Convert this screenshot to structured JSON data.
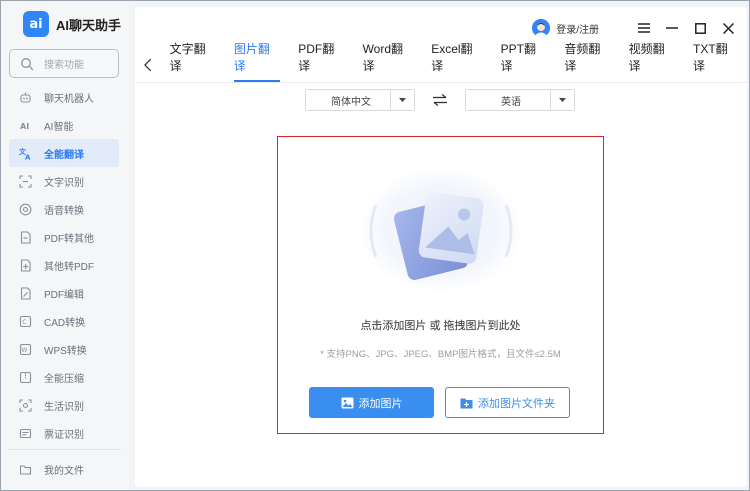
{
  "app": {
    "logo_text": "ai",
    "name": "AI聊天助手"
  },
  "search": {
    "placeholder": "搜索功能"
  },
  "sidebar": {
    "items": [
      {
        "label": "聊天机器人",
        "icon": "robot-icon",
        "active": false
      },
      {
        "label": "AI智能",
        "icon": "ai-icon",
        "active": false
      },
      {
        "label": "全能翻译",
        "icon": "translate-icon",
        "active": true
      },
      {
        "label": "文字识别",
        "icon": "scan-text-icon",
        "active": false
      },
      {
        "label": "语音转换",
        "icon": "audio-icon",
        "active": false
      },
      {
        "label": "PDF转其他",
        "icon": "pdf-convert-icon",
        "active": false
      },
      {
        "label": "其他转PDF",
        "icon": "to-pdf-icon",
        "active": false
      },
      {
        "label": "PDF编辑",
        "icon": "pdf-edit-icon",
        "active": false
      },
      {
        "label": "CAD转换",
        "icon": "cad-icon",
        "active": false
      },
      {
        "label": "WPS转换",
        "icon": "wps-icon",
        "active": false
      },
      {
        "label": "全能压缩",
        "icon": "compress-icon",
        "active": false
      },
      {
        "label": "生活识别",
        "icon": "life-scan-icon",
        "active": false
      },
      {
        "label": "票证识别",
        "icon": "ticket-icon",
        "active": false
      }
    ],
    "my_files": "我的文件"
  },
  "header": {
    "login_label": "登录/注册"
  },
  "tabs": [
    "文字翻译",
    "图片翻译",
    "PDF翻译",
    "Word翻译",
    "Excel翻译",
    "PPT翻译",
    "音频翻译",
    "视频翻译",
    "TXT翻译"
  ],
  "active_tab": "图片翻译",
  "language": {
    "source": "简体中文",
    "target": "英语"
  },
  "dropzone": {
    "title": "点击添加图片 或 拖拽图片到此处",
    "hint": "* 支持PNG、JPG、JPEG、BMP图片格式，且文件≤2.5M",
    "add_image_label": "添加图片",
    "add_folder_label": "添加图片文件夹"
  },
  "colors": {
    "accent": "#2e7bf0",
    "highlight_border": "#d9262b"
  }
}
